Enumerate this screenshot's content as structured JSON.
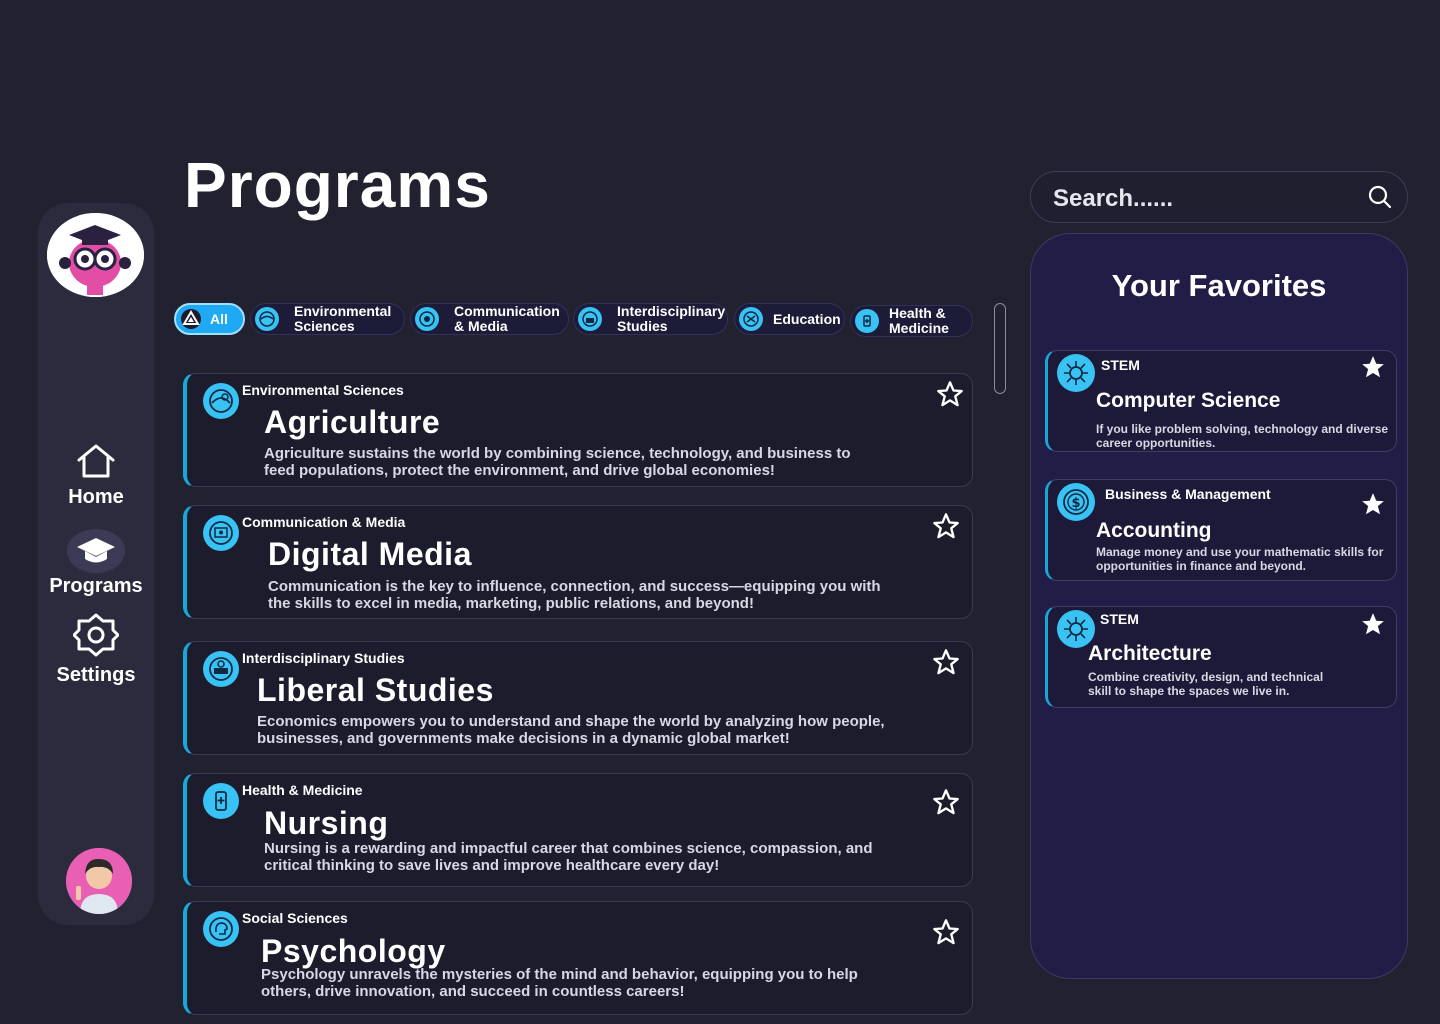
{
  "page_title": "Programs",
  "nav": {
    "home": "Home",
    "programs": "Programs",
    "settings": "Settings"
  },
  "filters": [
    {
      "label": "All",
      "active": true
    },
    {
      "label": "Environmental Sciences",
      "active": false
    },
    {
      "label": "Communication & Media",
      "active": false
    },
    {
      "label": "Interdisciplinary Studies",
      "active": false
    },
    {
      "label": "Education",
      "active": false
    },
    {
      "label": "Health & Medicine",
      "active": false
    }
  ],
  "programs": [
    {
      "category": "Environmental Sciences",
      "title": "Agriculture",
      "description": "Agriculture sustains the world by combining science, technology, and business to feed populations, protect the environment, and drive global economies!",
      "favorited": false,
      "icon": "environment-icon"
    },
    {
      "category": "Communication & Media",
      "title": "Digital Media",
      "description": "Communication is the key to influence, connection, and success—equipping you with the skills to excel in media, marketing, public relations, and beyond!",
      "favorited": false,
      "icon": "media-icon"
    },
    {
      "category": "Interdisciplinary Studies",
      "title": "Liberal Studies",
      "description": "Economics empowers you to understand and shape the world by analyzing how people, businesses, and governments make decisions in a dynamic global market!",
      "favorited": false,
      "icon": "interdisciplinary-icon"
    },
    {
      "category": "Health & Medicine",
      "title": "Nursing",
      "description": "Nursing is a rewarding and impactful career that combines science, compassion, and critical thinking to save lives and improve healthcare every day!",
      "favorited": false,
      "icon": "health-icon"
    },
    {
      "category": "Social Sciences",
      "title": "Psychology",
      "description": "Psychology unravels the mysteries of the mind and behavior, equipping you to help others, drive innovation, and succeed in countless careers!",
      "favorited": false,
      "icon": "psychology-icon"
    }
  ],
  "search": {
    "placeholder": "Search......"
  },
  "favorites": {
    "title": "Your Favorites",
    "items": [
      {
        "category": "STEM",
        "title": "Computer Science",
        "description": "If you like problem solving, technology and diverse career opportunities.",
        "icon": "stem-icon"
      },
      {
        "category": "Business & Management",
        "title": "Accounting",
        "description": "Manage money and use your mathematic skills for opportunities in finance and beyond.",
        "icon": "dollar-icon"
      },
      {
        "category": "STEM",
        "title": "Architecture",
        "description": "Combine creativity, design, and technical skill to shape the spaces we live in.",
        "icon": "stem-icon"
      }
    ]
  },
  "colors": {
    "background": "#21212f",
    "accent": "#39c3f5",
    "active_chip": "#1fa8f3",
    "favorites_panel": "#221d46"
  }
}
